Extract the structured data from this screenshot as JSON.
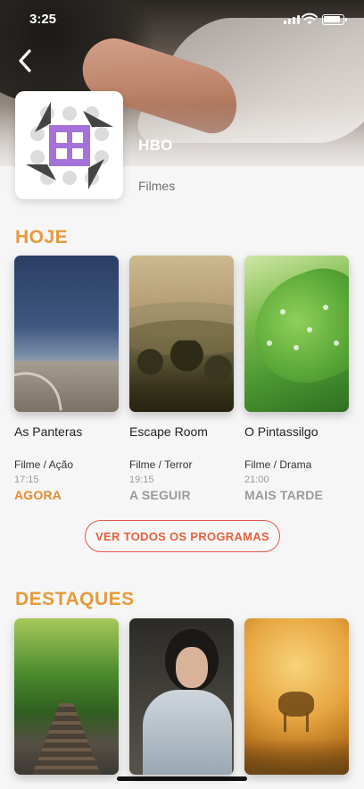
{
  "status_bar": {
    "time": "3:25"
  },
  "channel": {
    "name": "HBO",
    "genre": "Filmes"
  },
  "sections": {
    "today": {
      "title": "HOJE",
      "items": [
        {
          "title": "As Panteras",
          "genre": "Filme / Ação",
          "time": "17:15",
          "when": "AGORA"
        },
        {
          "title": "Escape Room",
          "genre": "Filme / Terror",
          "time": "19:15",
          "when": "A SEGUIR"
        },
        {
          "title": "O Pintassilgo",
          "genre": "Filme / Drama",
          "time": "21:00",
          "when": "MAIS TARDE"
        }
      ]
    },
    "view_all_label": "VER TODOS OS PROGRAMAS",
    "highlights": {
      "title": "DESTAQUES"
    }
  },
  "icons": {
    "back": "chevron-left-icon",
    "logo": "hbo-logo-icon"
  },
  "colors": {
    "accent": "#e79a3a",
    "now": "#e68a2e",
    "button_border": "#e5574d",
    "logo_purple": "#a472d8"
  }
}
